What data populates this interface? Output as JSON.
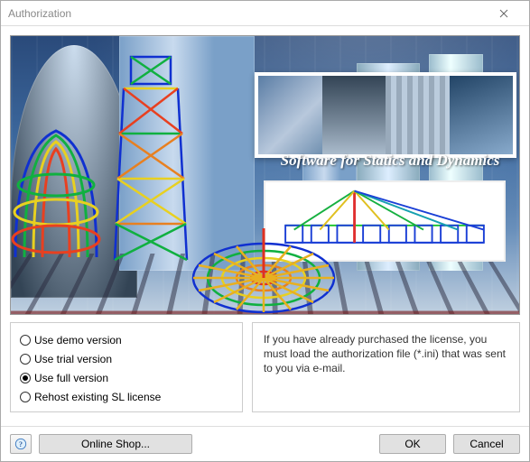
{
  "window": {
    "title": "Authorization"
  },
  "banner": {
    "tagline": "Software for Statics and Dynamics"
  },
  "options": {
    "items": [
      {
        "label": "Use demo version",
        "checked": false
      },
      {
        "label": "Use trial version",
        "checked": false
      },
      {
        "label": "Use full version",
        "checked": true
      },
      {
        "label": "Rehost existing SL license",
        "checked": false
      }
    ]
  },
  "description": {
    "text": "If you have already purchased the license, you must load the authorization file (*.ini) that was sent to you via e-mail."
  },
  "footer": {
    "online_shop": "Online Shop...",
    "ok": "OK",
    "cancel": "Cancel"
  }
}
